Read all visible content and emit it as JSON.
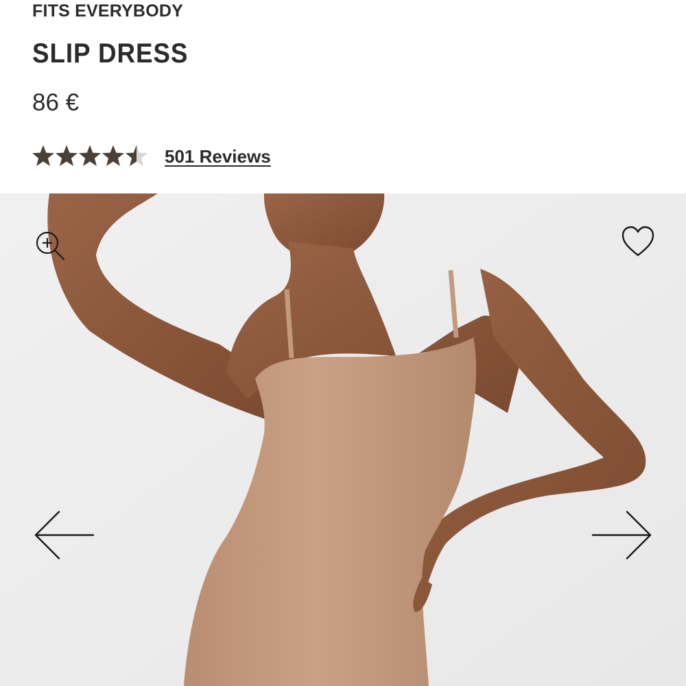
{
  "product": {
    "brand": "FITS EVERYBODY",
    "title": "SLIP DRESS",
    "price": "86 €",
    "rating": {
      "value": 4.5,
      "max": 5,
      "reviews_label": "501 Reviews"
    }
  },
  "gallery": {
    "zoom_icon": "zoom-in-icon",
    "favorite_icon": "heart-icon",
    "prev_icon": "arrow-left-icon",
    "next_icon": "arrow-right-icon"
  },
  "colors": {
    "text": "#2b2b2b",
    "star_filled": "#4a4038",
    "star_empty": "#d6d6d6",
    "gallery_bg": "#eeeeee",
    "dress": "#c59b7f",
    "skin": "#8c5a3c"
  }
}
